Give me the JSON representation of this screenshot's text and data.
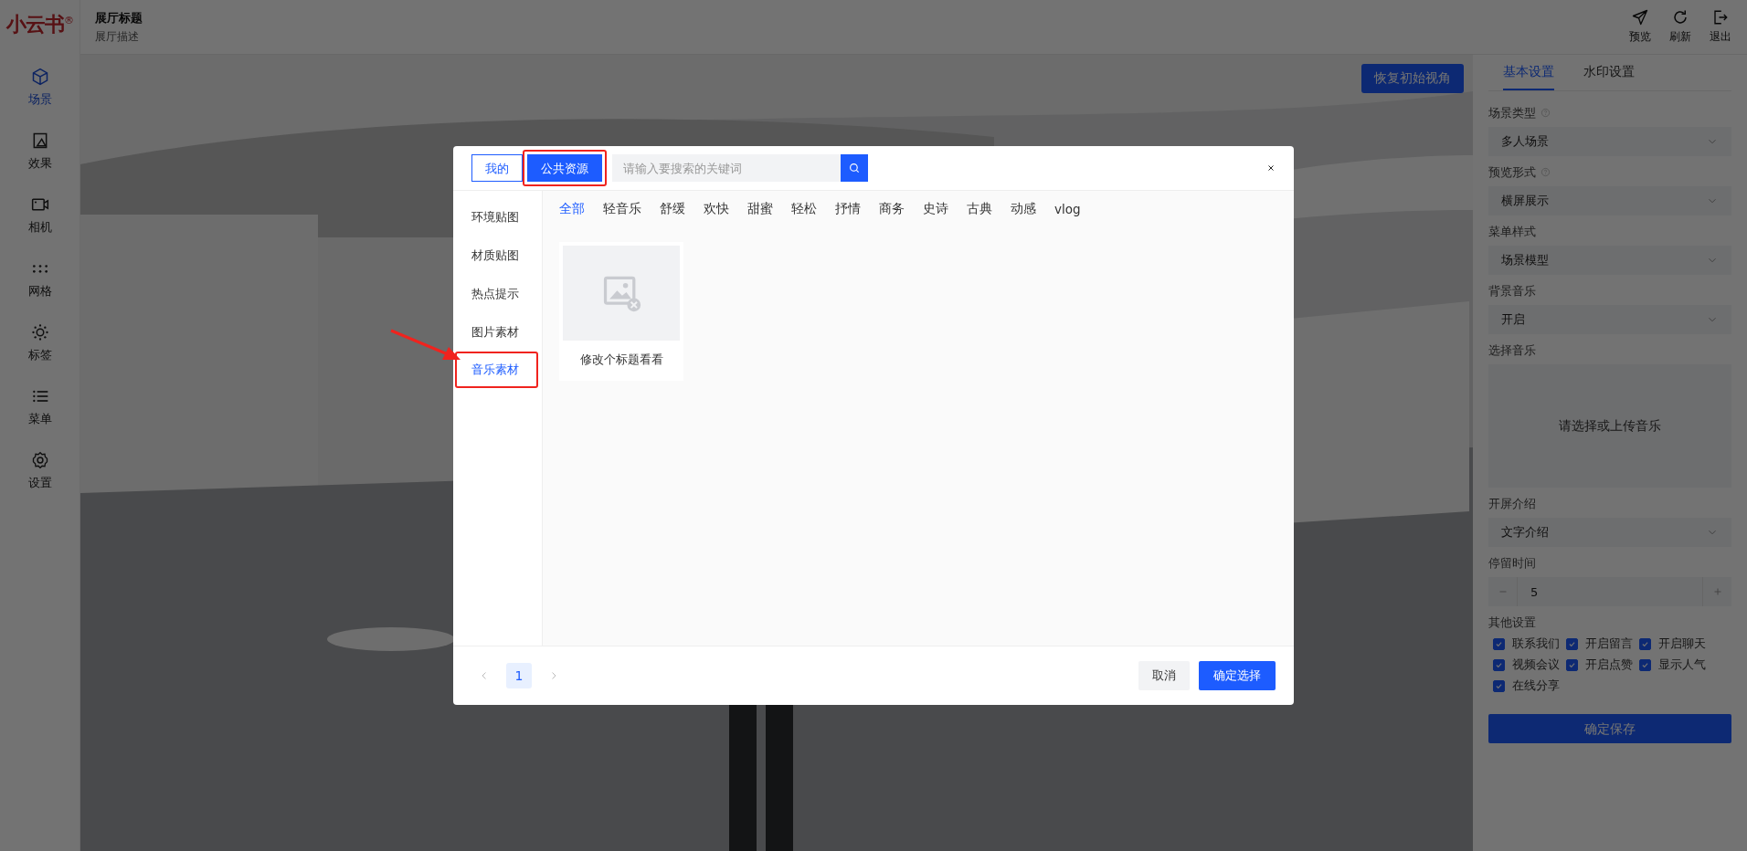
{
  "logo": {
    "text": "小云书$^{®}$"
  },
  "header": {
    "title": "展厅标题",
    "subtitle": "展厅描述",
    "actions": [
      {
        "label": "预览",
        "kind": "send"
      },
      {
        "label": "刷新",
        "kind": "refresh"
      },
      {
        "label": "退出",
        "kind": "exit"
      }
    ]
  },
  "sidebar": {
    "items": [
      {
        "label": "场景",
        "kind": "cube",
        "selected": true
      },
      {
        "label": "效果",
        "kind": "frame",
        "selected": false
      },
      {
        "label": "相机",
        "kind": "camera",
        "selected": false
      },
      {
        "label": "网格",
        "kind": "dots",
        "selected": false
      },
      {
        "label": "标签",
        "kind": "sun",
        "selected": false
      },
      {
        "label": "菜单",
        "kind": "list",
        "selected": false
      },
      {
        "label": "设置",
        "kind": "gear",
        "selected": false
      }
    ]
  },
  "scene": {
    "kind": "picture",
    "reset_button": "恢复初始视角"
  },
  "settings": {
    "tabs": [
      {
        "label": "基本设置",
        "selected": true
      },
      {
        "label": "水印设置",
        "selected": false
      }
    ],
    "fields": [
      {
        "kind": "select",
        "label": "场景类型",
        "help": true,
        "value": "多人场景"
      },
      {
        "kind": "select",
        "label": "预览形式",
        "help": true,
        "value": "横屏展示"
      },
      {
        "kind": "select",
        "label": "菜单样式",
        "help": false,
        "value": "场景模型"
      },
      {
        "kind": "select",
        "label": "背景音乐",
        "help": false,
        "value": "开启"
      },
      {
        "kind": "upload",
        "label": "选择音乐",
        "help": false,
        "placeholder": "请选择或上传音乐"
      },
      {
        "kind": "select",
        "label": "开屏介绍",
        "help": false,
        "value": "文字介绍"
      },
      {
        "kind": "stepper",
        "label": "停留时间",
        "help": false,
        "value": "5"
      },
      {
        "kind": "checkboxes",
        "label": "其他设置",
        "help": false,
        "options": [
          {
            "label": "联系我们",
            "checked": true
          },
          {
            "label": "开启留言",
            "checked": true
          },
          {
            "label": "开启聊天",
            "checked": true
          },
          {
            "label": "视频会议",
            "checked": true
          },
          {
            "label": "开启点赞",
            "checked": true
          },
          {
            "label": "显示人气",
            "checked": true
          },
          {
            "label": "在线分享",
            "checked": true
          }
        ]
      }
    ],
    "save_button": "确定保存"
  },
  "modal": {
    "tabs": [
      {
        "label": "我的",
        "selected": false,
        "highlighted": false
      },
      {
        "label": "公共资源",
        "selected": true,
        "highlighted": true
      }
    ],
    "search": {
      "placeholder": "请输入要搜索的关键词"
    },
    "categories": [
      {
        "label": "环境贴图",
        "selected": false,
        "highlighted": false
      },
      {
        "label": "材质贴图",
        "selected": false,
        "highlighted": false
      },
      {
        "label": "热点提示",
        "selected": false,
        "highlighted": false
      },
      {
        "label": "图片素材",
        "selected": false,
        "highlighted": false
      },
      {
        "label": "音乐素材",
        "selected": true,
        "highlighted": true
      }
    ],
    "filters": [
      {
        "label": "全部",
        "selected": true
      },
      {
        "label": "轻音乐",
        "selected": false
      },
      {
        "label": "舒缓",
        "selected": false
      },
      {
        "label": "欢快",
        "selected": false
      },
      {
        "label": "甜蜜",
        "selected": false
      },
      {
        "label": "轻松",
        "selected": false
      },
      {
        "label": "抒情",
        "selected": false
      },
      {
        "label": "商务",
        "selected": false
      },
      {
        "label": "史诗",
        "selected": false
      },
      {
        "label": "古典",
        "selected": false
      },
      {
        "label": "动感",
        "selected": false
      },
      {
        "label": "vlog",
        "selected": false
      }
    ],
    "items": [
      {
        "title": "修改个标题看看"
      }
    ],
    "pagination": {
      "pages": [
        {
          "label": "1",
          "selected": true
        }
      ]
    },
    "cancel_button": "取消",
    "confirm_button": "确定选择"
  }
}
